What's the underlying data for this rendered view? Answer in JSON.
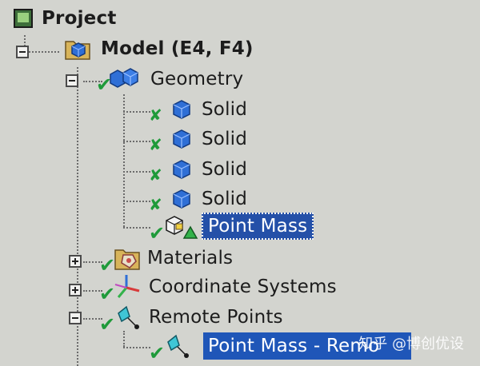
{
  "tree": {
    "project": {
      "label": "Project",
      "icon": "project-icon"
    },
    "model": {
      "label": "Model (E4, F4)",
      "icon": "model-icon"
    },
    "geometry": {
      "label": "Geometry",
      "icon": "geometry-icon"
    },
    "solids": [
      {
        "label": "Solid",
        "icon": "solid-body-icon"
      },
      {
        "label": "Solid",
        "icon": "solid-body-icon"
      },
      {
        "label": "Solid",
        "icon": "solid-body-icon"
      },
      {
        "label": "Solid",
        "icon": "solid-body-icon"
      }
    ],
    "point_mass": {
      "label": "Point Mass",
      "icon": "point-mass-icon",
      "selected": true
    },
    "materials": {
      "label": "Materials",
      "icon": "materials-icon"
    },
    "coordinate_systems": {
      "label": "Coordinate Systems",
      "icon": "coordinate-systems-icon"
    },
    "remote_points": {
      "label": "Remote Points",
      "icon": "remote-points-icon"
    },
    "remote_point_child": {
      "label": "Point Mass - Remo",
      "icon": "remote-point-icon",
      "selected": true
    }
  },
  "watermark": {
    "text": "知乎 @博创优设"
  },
  "colors": {
    "background": "#d3d4cf",
    "selection": "#2450a8",
    "check_green": "#1f9a3a",
    "solid_blue": "#2f6fd6"
  }
}
